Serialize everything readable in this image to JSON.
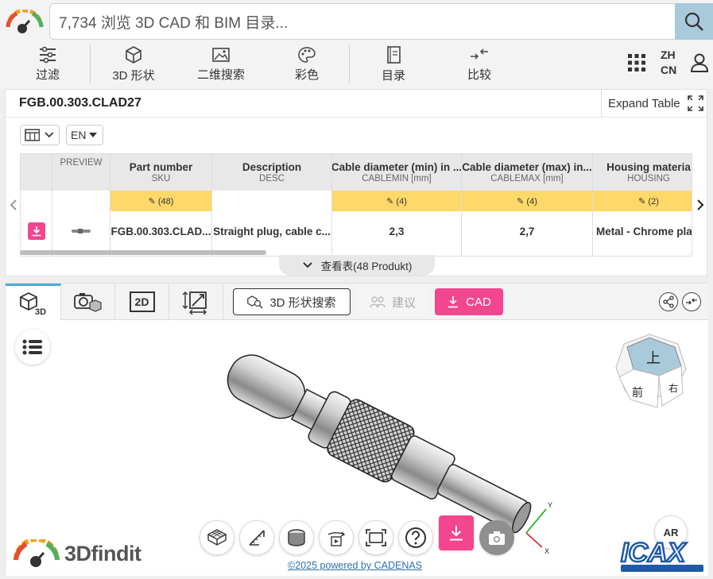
{
  "search": {
    "placeholder": "7,734 浏览 3D CAD 和 BIM 目录..."
  },
  "nav": {
    "filter": "过滤",
    "shape3d": "3D 形状",
    "search2d": "二维搜索",
    "color": "彩色",
    "catalog": "目录",
    "compare": "比较",
    "lang_top": "ZH",
    "lang_bottom": "CN"
  },
  "part": {
    "title": "FGB.00.303.CLAD27",
    "expand_label": "Expand Table",
    "lang_select": "EN",
    "view_table": "查看表(48 Produkt)"
  },
  "table": {
    "columns": [
      {
        "title": "",
        "sub": "",
        "filter": "",
        "value": ""
      },
      {
        "title": "PREVIEW",
        "sub": "",
        "filter": "",
        "value": ""
      },
      {
        "title": "Part number",
        "sub": "SKU",
        "filter": "✎ (48)",
        "value": "FGB.00.303.CLAD..."
      },
      {
        "title": "Description",
        "sub": "DESC",
        "filter": "",
        "value": "Straight plug, cable c..."
      },
      {
        "title": "Cable diameter (min) in ...",
        "sub": "CABLEMIN [mm]",
        "filter": "✎ (4)",
        "value": "2,3"
      },
      {
        "title": "Cable diameter (max) in...",
        "sub": "CABLEMAX [mm]",
        "filter": "✎ (4)",
        "value": "2,7"
      },
      {
        "title": "Housing materia",
        "sub": "HOUSING",
        "filter": "✎ (2)",
        "value": "Metal - Chrome plate"
      }
    ]
  },
  "viewer": {
    "tab_3d_label": "3D",
    "tab_2d_label": "2D",
    "shape_search": "3D 形状搜索",
    "suggest": "建议",
    "cad": "CAD",
    "cube_top": "上",
    "cube_front": "前",
    "cube_right": "右",
    "axis_x": "X",
    "axis_y": "Y",
    "ar_label": "AR",
    "powered": "©2025 powered by CADENAS",
    "brand": "3Dfindit",
    "watermark": "ICAX"
  },
  "colors": {
    "accent_pink": "#f2468e",
    "search_btn": "#a9cadb",
    "filter_yellow": "#ffd86a",
    "tab_active": "#4ca8d8"
  }
}
